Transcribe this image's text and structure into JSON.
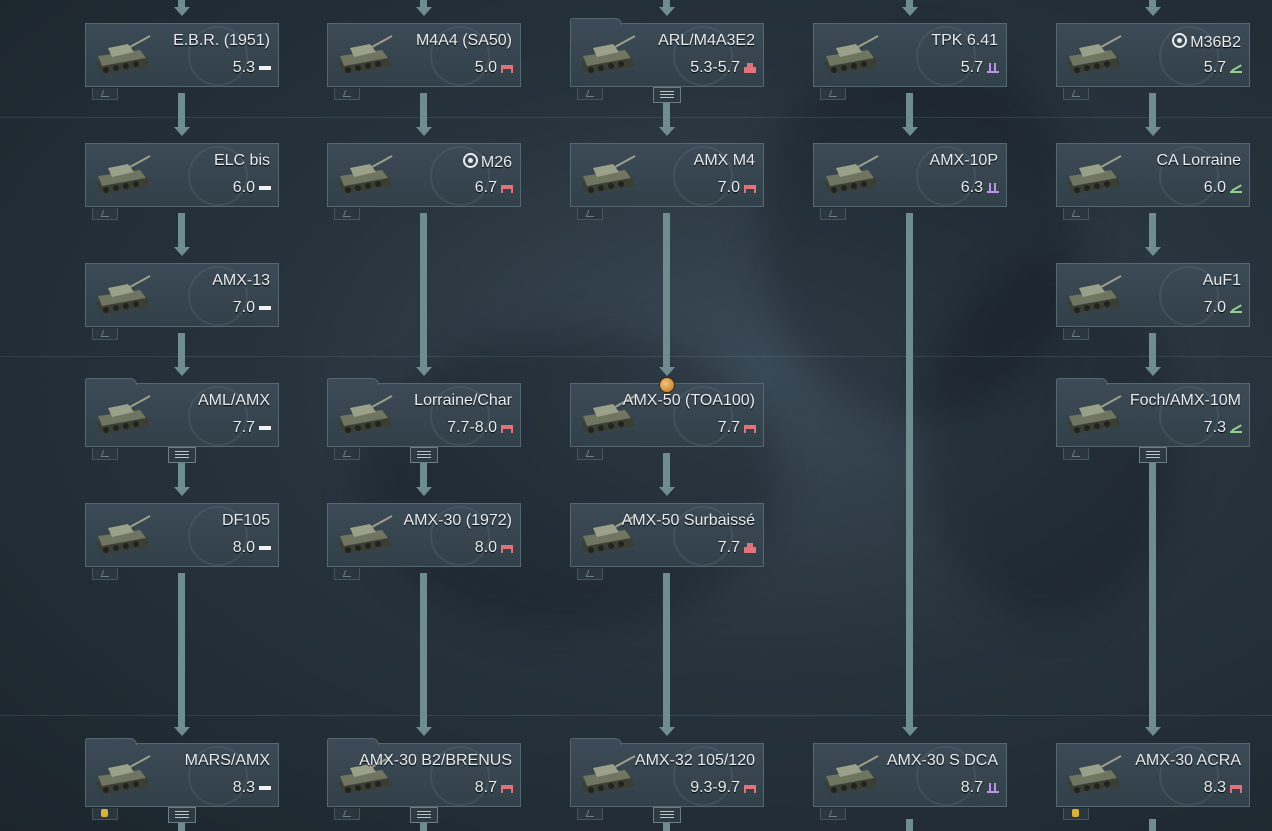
{
  "tree": {
    "columns": [
      {
        "id": "light",
        "cards": [
          {
            "name": "E.B.R. (1951)",
            "premium": false,
            "br": "5.3",
            "class": "light",
            "group": false
          },
          {
            "name": "ELC bis",
            "premium": false,
            "br": "6.0",
            "class": "light",
            "group": false
          },
          {
            "name": "AMX-13",
            "premium": false,
            "br": "7.0",
            "class": "light",
            "group": false
          },
          {
            "name": "AML/AMX",
            "premium": false,
            "br": "7.7",
            "class": "light",
            "group": true
          },
          {
            "name": "DF105",
            "premium": false,
            "br": "8.0",
            "class": "light",
            "group": false
          },
          {
            "name": "MARS/AMX",
            "premium": false,
            "br": "8.3",
            "class": "light",
            "group": true,
            "crew_slot": true
          }
        ]
      },
      {
        "id": "medium",
        "cards": [
          {
            "name": "M4A4 (SA50)",
            "premium": false,
            "br": "5.0",
            "class": "medium",
            "group": false
          },
          {
            "name": "M26",
            "premium": true,
            "br": "6.7",
            "class": "medium",
            "group": false
          },
          {
            "name": "Lorraine/Char",
            "premium": false,
            "br": "7.7-8.0",
            "class": "medium",
            "group": true
          },
          {
            "name": "AMX-30 (1972)",
            "premium": false,
            "br": "8.0",
            "class": "medium",
            "group": false
          },
          {
            "name": "AMX-30 B2/BRENUS",
            "premium": false,
            "br": "8.7",
            "class": "medium",
            "group": true
          }
        ]
      },
      {
        "id": "heavy",
        "cards": [
          {
            "name": "ARL/M4A3E2",
            "premium": false,
            "br": "5.3-5.7",
            "class": "heavy",
            "group": true
          },
          {
            "name": "AMX M4",
            "premium": false,
            "br": "7.0",
            "class": "medium",
            "group": false
          },
          {
            "name": "AMX-50 (TOA100)",
            "premium": false,
            "br": "7.7",
            "class": "medium",
            "group": false,
            "reward": true
          },
          {
            "name": "AMX-50 Surbaissé",
            "premium": false,
            "br": "7.7",
            "class": "heavy",
            "group": false
          },
          {
            "name": "AMX-32 105/120",
            "premium": false,
            "br": "9.3-9.7",
            "class": "medium",
            "group": true
          }
        ]
      },
      {
        "id": "spaa",
        "cards": [
          {
            "name": "TPK 6.41",
            "premium": false,
            "br": "5.7",
            "class": "spaa",
            "group": false
          },
          {
            "name": "AMX-10P",
            "premium": false,
            "br": "6.3",
            "class": "spaa",
            "group": false
          },
          {
            "name": "AMX-30 S DCA",
            "premium": false,
            "br": "8.7",
            "class": "spaa",
            "group": false
          }
        ]
      },
      {
        "id": "td",
        "cards": [
          {
            "name": "M36B2",
            "premium": true,
            "br": "5.7",
            "class": "td",
            "group": false
          },
          {
            "name": "CA Lorraine",
            "premium": false,
            "br": "6.0",
            "class": "td",
            "group": false
          },
          {
            "name": "AuF1",
            "premium": false,
            "br": "7.0",
            "class": "td",
            "group": false
          },
          {
            "name": "Foch/AMX-10M",
            "premium": false,
            "br": "7.3",
            "class": "td",
            "group": true
          },
          {
            "name": "AMX-30 ACRA",
            "premium": false,
            "br": "8.3",
            "class": "medium",
            "group": false,
            "crew_slot": true
          }
        ]
      }
    ]
  },
  "colors": {
    "connector": "#6f8d8e",
    "light_class": "#f1f1f1",
    "medium_heavy_class": "#e2727a",
    "spaa_class": "#b993e6",
    "td_class": "#8fd28b"
  },
  "icons": {
    "premium": "premium-target-icon",
    "group": "group-list-icon",
    "slot": "vehicle-slot-icon",
    "crew": "crew-member-icon",
    "reward": "reward-medal-icon"
  }
}
